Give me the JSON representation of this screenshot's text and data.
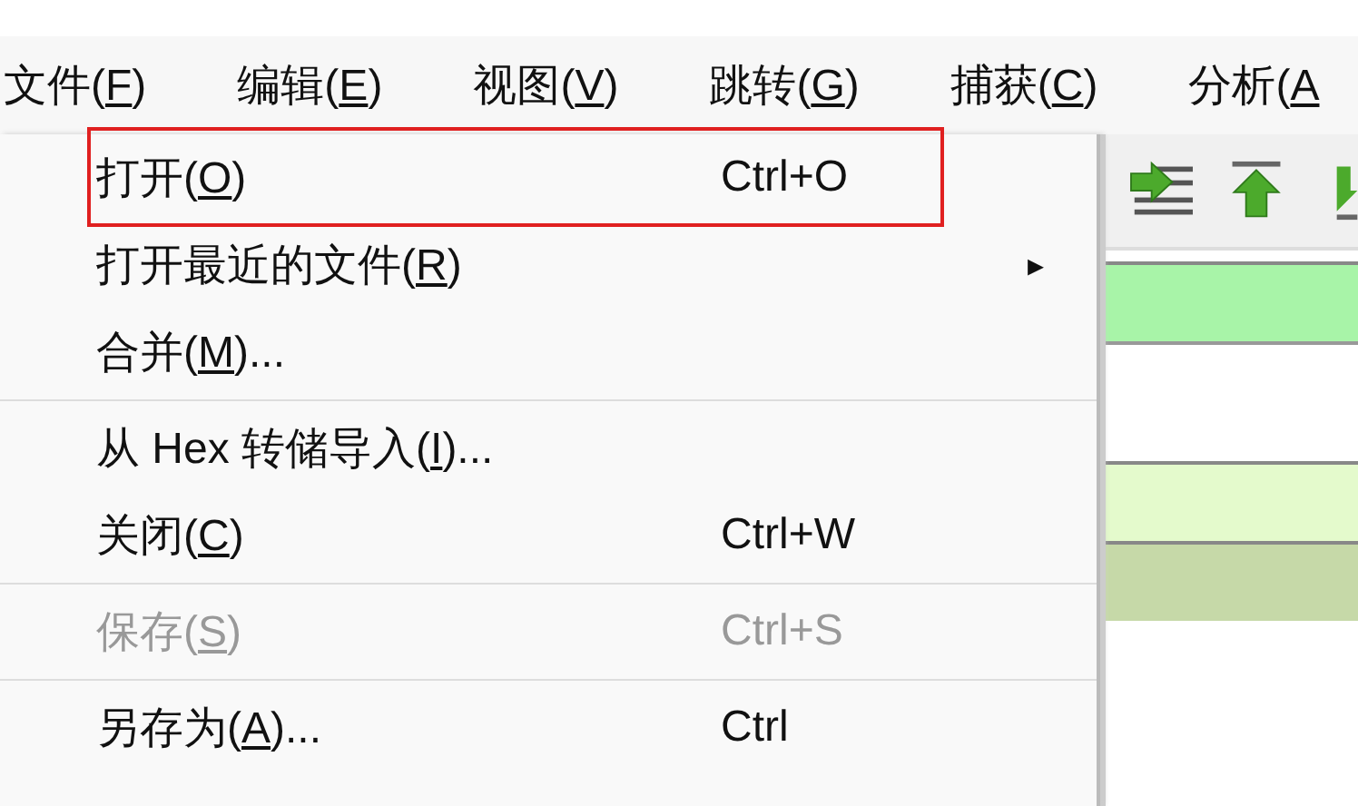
{
  "menubar": [
    {
      "before": "文件(",
      "key": "F",
      "after": ")"
    },
    {
      "before": "编辑(",
      "key": "E",
      "after": ")"
    },
    {
      "before": "视图(",
      "key": "V",
      "after": ")"
    },
    {
      "before": "跳转(",
      "key": "G",
      "after": ")"
    },
    {
      "before": "捕获(",
      "key": "C",
      "after": ")"
    },
    {
      "before": "分析(",
      "key": "A"
    }
  ],
  "menu": [
    {
      "kind": "item",
      "before": "打开(",
      "key": "O",
      "after": ")",
      "shortcut": "Ctrl+O",
      "disabled": false,
      "highlighted": true
    },
    {
      "kind": "submenu",
      "before": "打开最近的文件(",
      "key": "R",
      "after": ")",
      "arrow": "▸",
      "disabled": false,
      "highlighted": false
    },
    {
      "kind": "item",
      "before": "合并(",
      "key": "M",
      "after": ")...",
      "disabled": false,
      "highlighted": false
    },
    {
      "kind": "separator"
    },
    {
      "kind": "item",
      "before": "从 Hex 转储导入(",
      "key": "I",
      "after": ")...",
      "disabled": false,
      "highlighted": false
    },
    {
      "kind": "item",
      "before": "关闭(",
      "key": "C",
      "after": ")",
      "shortcut": "Ctrl+W",
      "disabled": false,
      "highlighted": false
    },
    {
      "kind": "separator"
    },
    {
      "kind": "item",
      "before": "保存(",
      "key": "S",
      "after": ")",
      "shortcut": "Ctrl+S",
      "disabled": true,
      "highlighted": false
    },
    {
      "kind": "separator"
    },
    {
      "kind": "item",
      "before": "另存为(",
      "key": "A",
      "after": ")...",
      "shortcut": "Ctrl",
      "disabled": false,
      "highlighted": false
    }
  ],
  "packet_rows": [
    {
      "color": "#a8f4a8"
    },
    {
      "color": "#ffffff"
    },
    {
      "color": "#e4facc"
    },
    {
      "color": "#c6d9a8"
    }
  ]
}
